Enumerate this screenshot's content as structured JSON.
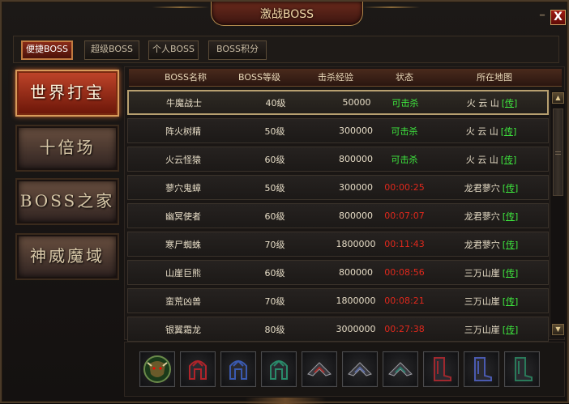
{
  "window": {
    "title": "激战BOSS",
    "close_label": "X",
    "min_label": "━"
  },
  "top_tabs": [
    {
      "label": "便捷BOSS",
      "active": true
    },
    {
      "label": "超级BOSS",
      "active": false
    },
    {
      "label": "个人BOSS",
      "active": false
    },
    {
      "label": "BOSS积分",
      "active": false
    }
  ],
  "side_menu": [
    {
      "label": "世界打宝",
      "active": true
    },
    {
      "label": "十倍场",
      "active": false
    },
    {
      "label": "BOSS之家",
      "active": false
    },
    {
      "label": "神威魔域",
      "active": false
    }
  ],
  "table": {
    "headers": [
      "BOSS名称",
      "BOSS等级",
      "击杀经验",
      "状态",
      "所在地图"
    ],
    "rows": [
      {
        "name": "牛魔战士",
        "level": "40级",
        "exp": "50000",
        "status": "可击杀",
        "status_type": "ok",
        "map": "火 云 山",
        "link": "[传]"
      },
      {
        "name": "阵火树精",
        "level": "50级",
        "exp": "300000",
        "status": "可击杀",
        "status_type": "ok",
        "map": "火 云 山",
        "link": "[传]"
      },
      {
        "name": "火云怪猿",
        "level": "60级",
        "exp": "800000",
        "status": "可击杀",
        "status_type": "ok",
        "map": "火 云 山",
        "link": "[传]"
      },
      {
        "name": "蓼穴鬼蟑",
        "level": "50级",
        "exp": "300000",
        "status": "00:00:25",
        "status_type": "timer",
        "map": "龙君蓼穴",
        "link": "[传]"
      },
      {
        "name": "幽冥使者",
        "level": "60级",
        "exp": "800000",
        "status": "00:07:07",
        "status_type": "timer",
        "map": "龙君蓼穴",
        "link": "[传]"
      },
      {
        "name": "寒尸蜘蛛",
        "level": "70级",
        "exp": "1800000",
        "status": "00:11:43",
        "status_type": "timer",
        "map": "龙君蓼穴",
        "link": "[传]"
      },
      {
        "name": "山崖巨熊",
        "level": "60级",
        "exp": "800000",
        "status": "00:08:56",
        "status_type": "timer",
        "map": "三万山崖",
        "link": "[传]"
      },
      {
        "name": "蛮荒凶兽",
        "level": "70级",
        "exp": "1800000",
        "status": "00:08:21",
        "status_type": "timer",
        "map": "三万山崖",
        "link": "[传]"
      },
      {
        "name": "银翼霜龙",
        "level": "80级",
        "exp": "3000000",
        "status": "00:27:38",
        "status_type": "timer",
        "map": "三万山崖",
        "link": "[传]"
      }
    ]
  },
  "scroll": {
    "up": "▲",
    "down": "▼"
  },
  "reward_items": [
    {
      "icon": "bull-head-icon",
      "color": "#6a5a2a"
    },
    {
      "icon": "red-helmet-icon",
      "color": "#b0242a"
    },
    {
      "icon": "blue-helmet-icon",
      "color": "#3a5ab0"
    },
    {
      "icon": "green-helmet-icon",
      "color": "#2a8a6a"
    },
    {
      "icon": "red-shoulder-armor-icon",
      "color": "#a02a28"
    },
    {
      "icon": "blue-shoulder-armor-icon",
      "color": "#5a6aa0"
    },
    {
      "icon": "green-shoulder-armor-icon",
      "color": "#2a7a6a"
    },
    {
      "icon": "red-boots-icon",
      "color": "#a0282e"
    },
    {
      "icon": "blue-boots-icon",
      "color": "#4a5ab0"
    },
    {
      "icon": "green-boots-icon",
      "color": "#2a7a5a"
    }
  ]
}
